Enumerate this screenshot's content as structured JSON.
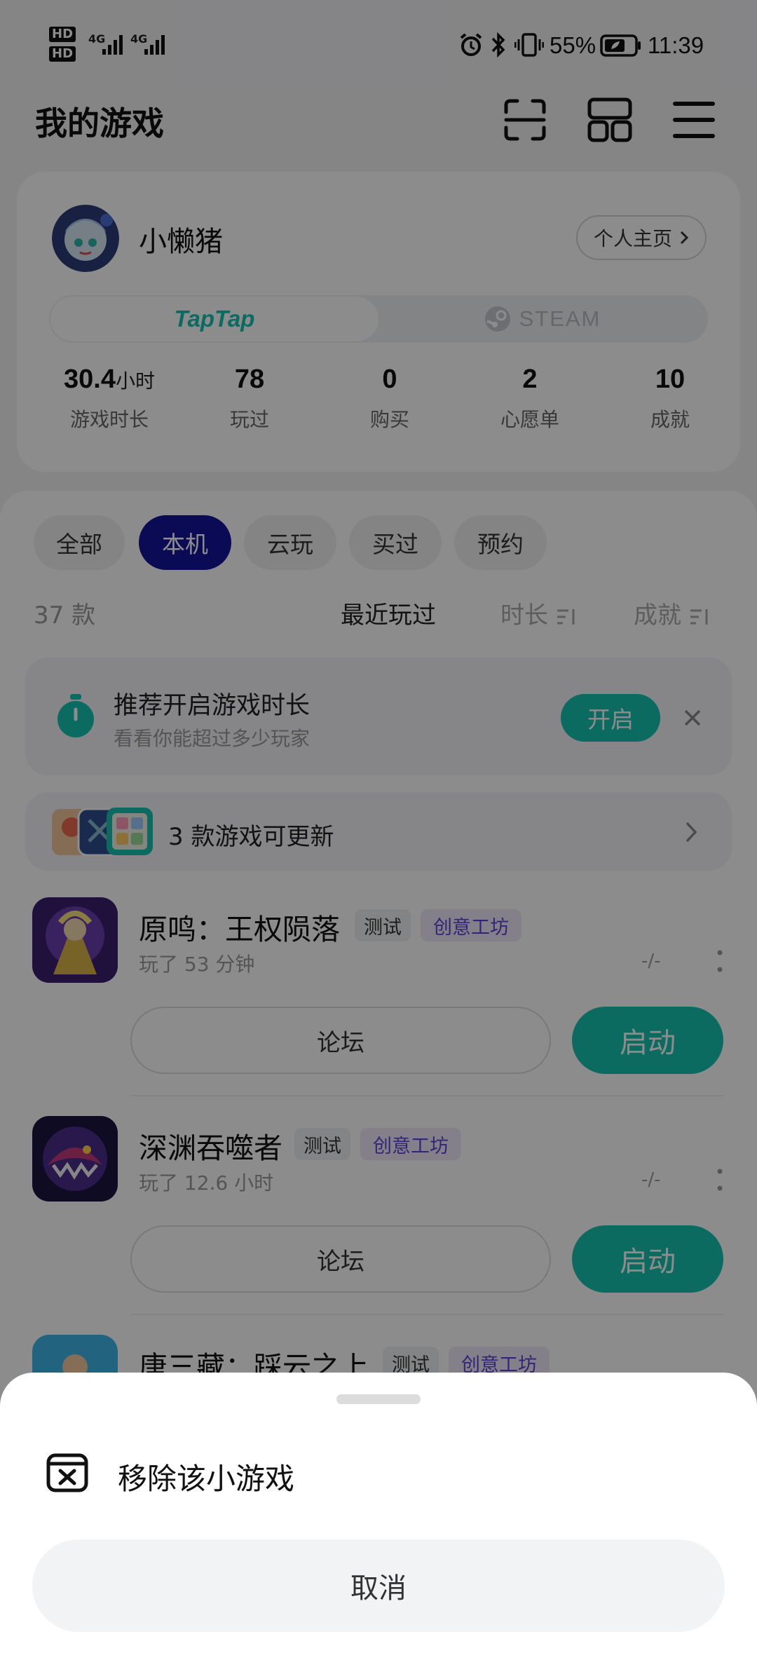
{
  "status_bar": {
    "hd1": "HD",
    "hd2": "HD",
    "net1": "4G",
    "net2": "4G",
    "battery_pct": "55%",
    "time": "11:39"
  },
  "header": {
    "title": "我的游戏",
    "icons": [
      "scan-icon",
      "grid-icon",
      "menu-icon"
    ]
  },
  "profile": {
    "username": "小懒猪",
    "home_button": "个人主页",
    "platforms": [
      "TapTap",
      "STEAM"
    ],
    "stats": [
      {
        "value": "30.4",
        "unit": "小时",
        "label": "游戏时长"
      },
      {
        "value": "78",
        "unit": "",
        "label": "玩过"
      },
      {
        "value": "0",
        "unit": "",
        "label": "购买"
      },
      {
        "value": "2",
        "unit": "",
        "label": "心愿单"
      },
      {
        "value": "10",
        "unit": "",
        "label": "成就"
      }
    ]
  },
  "filters": {
    "chips": [
      "全部",
      "本机",
      "云玩",
      "买过",
      "预约"
    ],
    "active_chip": "本机",
    "count": "37 款",
    "sorts": [
      "最近玩过",
      "时长",
      "成就"
    ]
  },
  "banner": {
    "title": "推荐开启游戏时长",
    "subtitle": "看看你能超过多少玩家",
    "button": "开启"
  },
  "updates": {
    "text": "3 款游戏可更新"
  },
  "games": [
    {
      "name": "原鸣：王权陨落",
      "tag1": "测试",
      "tag2": "创意工坊",
      "played": "玩了 53 分钟",
      "rating": "-/-",
      "forum": "论坛",
      "launch": "启动"
    },
    {
      "name": "深渊吞噬者",
      "tag1": "测试",
      "tag2": "创意工坊",
      "played": "玩了 12.6 小时",
      "rating": "-/-",
      "forum": "论坛",
      "launch": "启动"
    },
    {
      "name": "唐三藏：踩云之上",
      "tag1": "测试",
      "tag2": "创意工坊",
      "played": "",
      "rating": "",
      "forum": "",
      "launch": ""
    }
  ],
  "sheet": {
    "remove_label": "移除该小游戏",
    "cancel_label": "取消"
  },
  "colors": {
    "accent": "#16c3b1",
    "chip_active": "#13149a",
    "workshop_tag": "#5c44d6"
  }
}
